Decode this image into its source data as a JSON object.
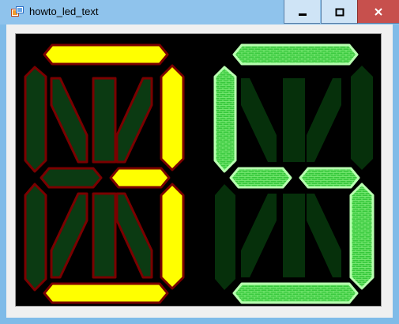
{
  "window": {
    "title": "howto_led_text",
    "controls": {
      "minimize_icon": "minimize-icon",
      "maximize_icon": "maximize-icon",
      "close_icon": "close-icon"
    }
  },
  "display": {
    "background": "#000000",
    "digits": [
      {
        "style": "solid",
        "on_fill": "#ffff00",
        "on_stroke": "#7a0000",
        "off_fill": "#0b3a12",
        "off_stroke": "#7a0000",
        "segments_on": [
          "top",
          "upper-right",
          "middle-right",
          "lower-right",
          "bottom"
        ]
      },
      {
        "style": "brick",
        "on_fill": "#36c73b",
        "on_stroke": "#b8ffb0",
        "off_fill": "#06300b",
        "off_stroke": "none",
        "segments_on": [
          "top",
          "upper-left",
          "middle-left",
          "middle-right",
          "lower-right",
          "bottom"
        ]
      }
    ]
  }
}
